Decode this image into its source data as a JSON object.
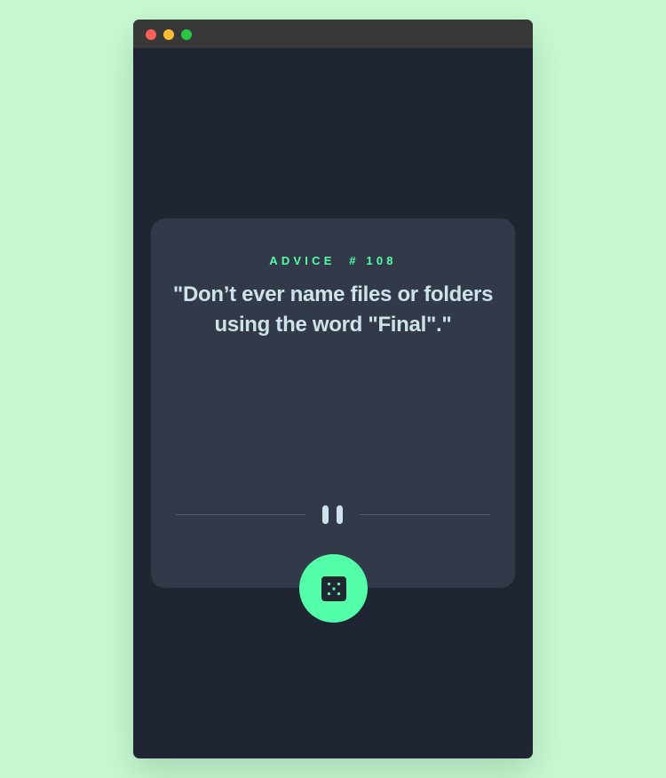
{
  "window": {
    "buttons": [
      "close",
      "minimize",
      "maximize"
    ]
  },
  "advice": {
    "heading": "ADVICE  # 108",
    "quote": "\"Don’t ever name files or folders using the word \"Final\".\""
  },
  "divider": {
    "icon": "pause-icon"
  },
  "dice_button": {
    "icon": "dice-icon"
  },
  "colors": {
    "page_background": "#c8f9d2",
    "window_background": "#1f2532",
    "card_background": "#323a49",
    "accent": "#52ffa8",
    "text": "#cee3e9",
    "divider": "#4f5d74"
  }
}
